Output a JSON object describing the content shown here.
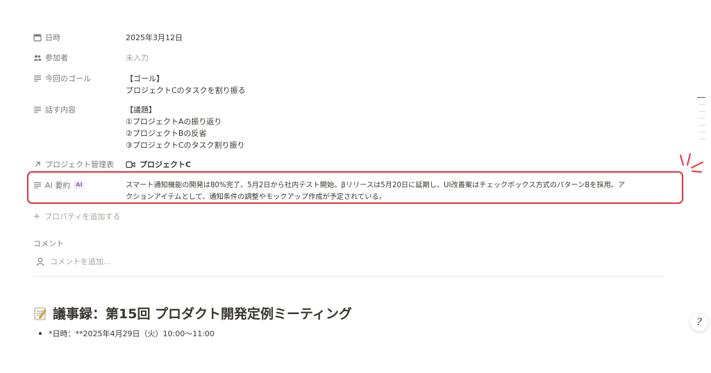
{
  "properties": {
    "date": {
      "label": "日時",
      "value": "2025年3月12日"
    },
    "attendees": {
      "label": "参加者",
      "value": "未入力"
    },
    "goal": {
      "label": "今回のゴール",
      "lines": [
        "【ゴール】",
        "プロジェクトCのタスクを割り振る"
      ]
    },
    "topics": {
      "label": "話す内容",
      "lines": [
        "【議題】",
        "①プロジェクトAの振り返り",
        "②プロジェクトBの反省",
        "③プロジェクトCのタスク割り振り"
      ]
    },
    "project": {
      "label": "プロジェクト管理表",
      "value": "プロジェクトC"
    },
    "ai_summary": {
      "label": "AI 要約",
      "badge": "AI",
      "lines": [
        "スマート通知機能の開発は80%完了、5月2日から社内テスト開始。βリリースは5月20日に延期し、UI改善案はチェックボックス方式のパターンBを採用。ア",
        "クションアイテムとして、通知条件の調整やモックアップ作成が予定されている。"
      ]
    }
  },
  "add_property_label": "プロパティを追加する",
  "comments": {
    "title": "コメント",
    "placeholder": "コメントを追加..."
  },
  "page_heading": "議事録：第15回 プロダクト開発定例ミーティング",
  "bullets": [
    "*日時：**2025年4月29日（火）10:00〜11:00"
  ],
  "icons": {
    "date": "calendar-icon",
    "attendees": "people-icon",
    "text": "text-lines-icon",
    "relation": "arrow-up-right-icon",
    "page": "video-page-icon",
    "add": "plus-icon",
    "comment_avatar": "avatar-icon",
    "heading": "memo-icon",
    "help": "help-icon"
  },
  "colors": {
    "highlight": "#e5303a",
    "ai_badge": "#9065b0"
  }
}
